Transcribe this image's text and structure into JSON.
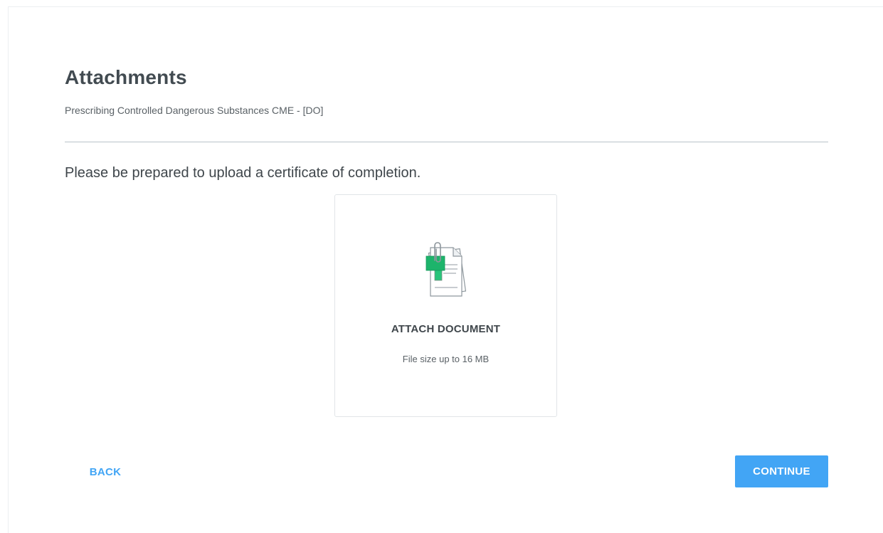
{
  "header": {
    "title": "Attachments",
    "subtitle": "Prescribing Controlled Dangerous Substances CME - [DO]"
  },
  "instruction": "Please be prepared to upload a certificate of completion.",
  "attach": {
    "icon": "document-attachment-icon",
    "label": "ATTACH DOCUMENT",
    "hint": "File size up to 16 MB"
  },
  "footer": {
    "back_label": "BACK",
    "continue_label": "CONTINUE"
  },
  "colors": {
    "accent": "#42a5f5",
    "icon_green": "#1db46b",
    "text_dark": "#424b51"
  }
}
